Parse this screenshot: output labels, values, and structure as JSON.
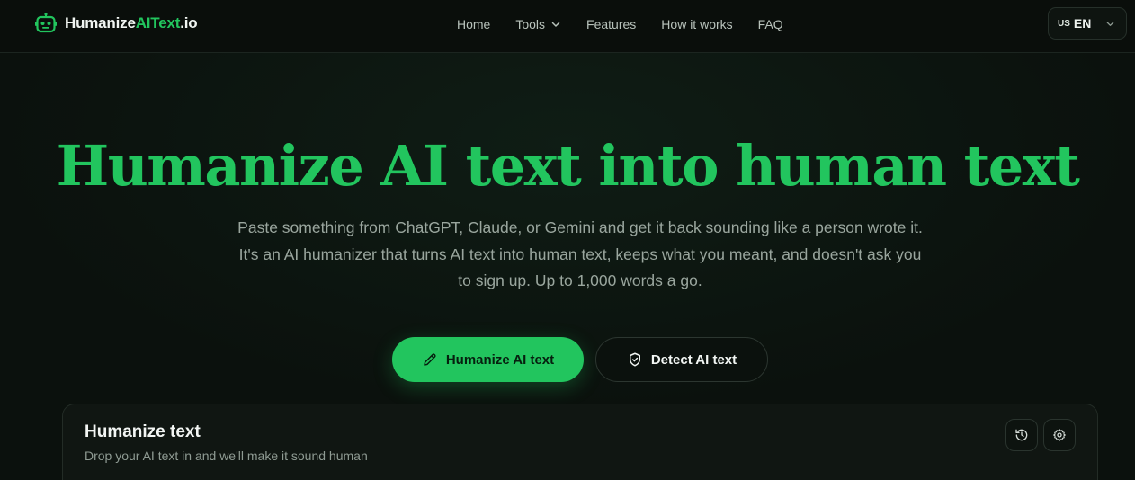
{
  "header": {
    "logo": {
      "text_main": "Humanize",
      "text_accent": "AIText",
      "text_suffix": ".io",
      "icon": "robot-icon"
    },
    "nav": [
      {
        "label": "Home"
      },
      {
        "label": "Tools",
        "icon": "chevron-down-icon"
      },
      {
        "label": "Features"
      },
      {
        "label": "How it works"
      },
      {
        "label": "FAQ"
      }
    ],
    "language": {
      "flag": "US",
      "code": "EN",
      "icon": "chevron-down-icon"
    }
  },
  "hero": {
    "title": "Humanize AI text into human text",
    "subtitle": "Paste something from ChatGPT, Claude, or Gemini and get it back sounding like a person wrote it. It's an AI humanizer that turns AI text into human text, keeps what you meant, and doesn't ask you to sign up. Up to 1,000 words a go.",
    "primary_button": {
      "label": "Humanize AI text",
      "icon": "pencil-icon"
    },
    "secondary_button": {
      "label": "Detect AI text",
      "icon": "shield-check-icon"
    }
  },
  "card": {
    "title": "Humanize text",
    "subtitle": "Drop your AI text in and we'll make it sound human",
    "actions": [
      {
        "icon": "history-icon"
      },
      {
        "icon": "gear-icon"
      }
    ]
  },
  "colors": {
    "accent": "#22c55e",
    "background": "#0b110d",
    "text_muted": "#9aa69e"
  }
}
